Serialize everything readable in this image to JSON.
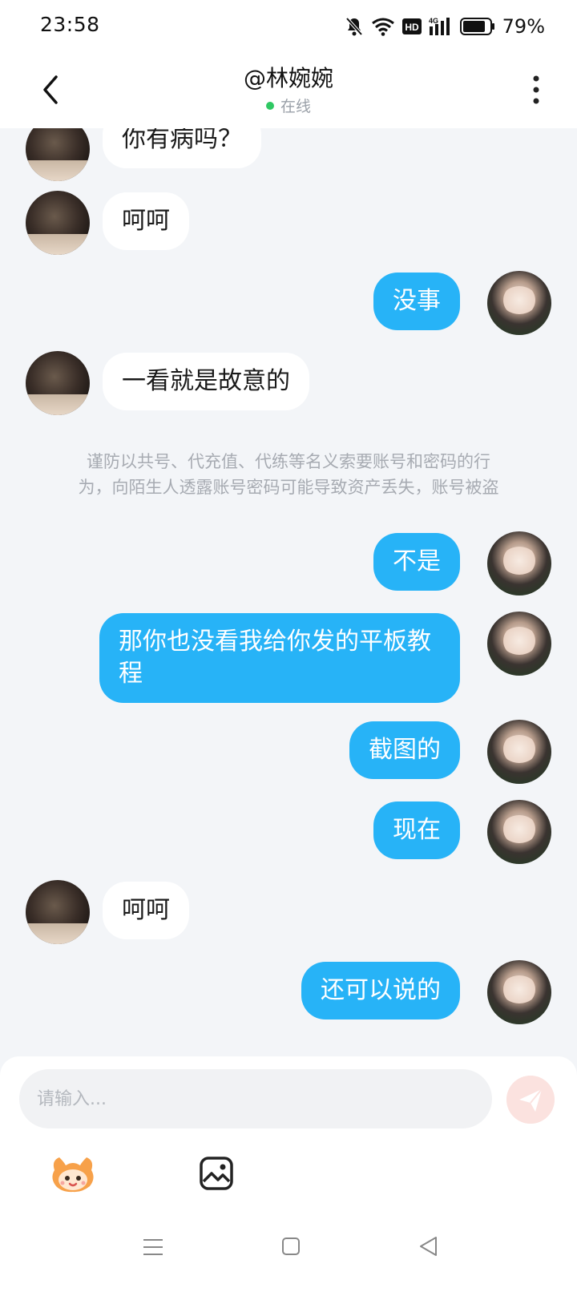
{
  "status_bar": {
    "time": "23:58",
    "battery_percent": "79%",
    "icons": [
      "bell-mute-icon",
      "wifi-icon",
      "hd-icon",
      "4g-signal-icon",
      "battery-icon"
    ]
  },
  "header": {
    "title": "@林婉婉",
    "status": "在线",
    "status_color": "#2fc863"
  },
  "messages": [
    {
      "from": "other",
      "text": "你有病吗？"
    },
    {
      "from": "other",
      "text": "呵呵"
    },
    {
      "from": "self",
      "text": "没事"
    },
    {
      "from": "other",
      "text": "一看就是故意的"
    },
    {
      "from": "self",
      "text": "不是"
    },
    {
      "from": "self",
      "text": "那你也没看我给你发的平板教程"
    },
    {
      "from": "self",
      "text": "截图的"
    },
    {
      "from": "self",
      "text": "现在"
    },
    {
      "from": "other",
      "text": "呵呵"
    },
    {
      "from": "self",
      "text": "还可以说的"
    }
  ],
  "notice": {
    "line1": "谨防以共号、代充值、代练等名义索要账号和密码的行",
    "line2": "为，向陌生人透露账号密码可能导致资产丢失，账号被盗"
  },
  "composer": {
    "placeholder": "请输入...",
    "tools": [
      "emoji-icon",
      "image-icon"
    ]
  },
  "colors": {
    "self_bubble": "#27b3f7",
    "other_bubble": "#ffffff",
    "background": "#f3f5f8",
    "send_button": "#fbe2df"
  }
}
